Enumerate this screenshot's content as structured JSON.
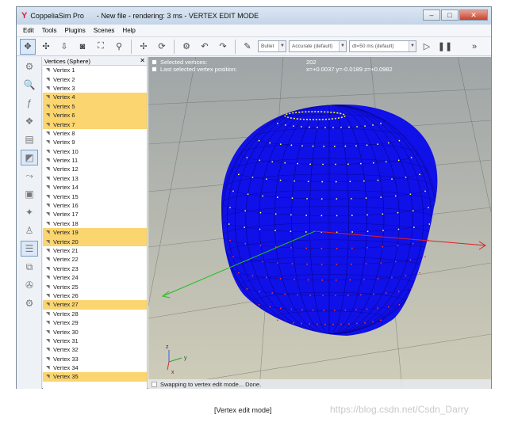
{
  "window": {
    "app_name": "CoppeliaSim Pro",
    "title": "- New file - rendering: 3 ms - VERTEX EDIT MODE"
  },
  "menu": [
    "Edit",
    "Tools",
    "Plugins",
    "Scenes",
    "Help"
  ],
  "toolbar": {
    "engine": "Bullet",
    "accuracy": "Accurate (default)",
    "timestep": "dt=50 ms (default)"
  },
  "panel": {
    "title": "Vertices (Sphere)",
    "vertices": [
      {
        "label": "Vertex 1",
        "selected": false
      },
      {
        "label": "Vertex 2",
        "selected": false
      },
      {
        "label": "Vertex 3",
        "selected": false
      },
      {
        "label": "Vertex 4",
        "selected": true
      },
      {
        "label": "Vertex 5",
        "selected": true
      },
      {
        "label": "Vertex 6",
        "selected": true
      },
      {
        "label": "Vertex 7",
        "selected": true
      },
      {
        "label": "Vertex 8",
        "selected": false
      },
      {
        "label": "Vertex 9",
        "selected": false
      },
      {
        "label": "Vertex 10",
        "selected": false
      },
      {
        "label": "Vertex 11",
        "selected": false
      },
      {
        "label": "Vertex 12",
        "selected": false
      },
      {
        "label": "Vertex 13",
        "selected": false
      },
      {
        "label": "Vertex 14",
        "selected": false
      },
      {
        "label": "Vertex 15",
        "selected": false
      },
      {
        "label": "Vertex 16",
        "selected": false
      },
      {
        "label": "Vertex 17",
        "selected": false
      },
      {
        "label": "Vertex 18",
        "selected": false
      },
      {
        "label": "Vertex 19",
        "selected": true
      },
      {
        "label": "Vertex 20",
        "selected": true
      },
      {
        "label": "Vertex 21",
        "selected": false
      },
      {
        "label": "Vertex 22",
        "selected": false
      },
      {
        "label": "Vertex 23",
        "selected": false
      },
      {
        "label": "Vertex 24",
        "selected": false
      },
      {
        "label": "Vertex 25",
        "selected": false
      },
      {
        "label": "Vertex 26",
        "selected": false
      },
      {
        "label": "Vertex 27",
        "selected": true
      },
      {
        "label": "Vertex 28",
        "selected": false
      },
      {
        "label": "Vertex 29",
        "selected": false
      },
      {
        "label": "Vertex 30",
        "selected": false
      },
      {
        "label": "Vertex 31",
        "selected": false
      },
      {
        "label": "Vertex 32",
        "selected": false
      },
      {
        "label": "Vertex 33",
        "selected": false
      },
      {
        "label": "Vertex 34",
        "selected": false
      },
      {
        "label": "Vertex 35",
        "selected": true
      }
    ]
  },
  "viewport": {
    "selected_label": "Selected vertices:",
    "selected_count": "202",
    "last_label": "Last selected vertex position:",
    "last_position": "x=+0.0037 y=-0.0189 z=+0.0982",
    "status": "Swapping to vertex edit mode... Done.",
    "sphere_color": "#1010e8"
  },
  "caption": "[Vertex edit mode]",
  "watermark": "https://blog.csdn.net/Csdn_Darry"
}
